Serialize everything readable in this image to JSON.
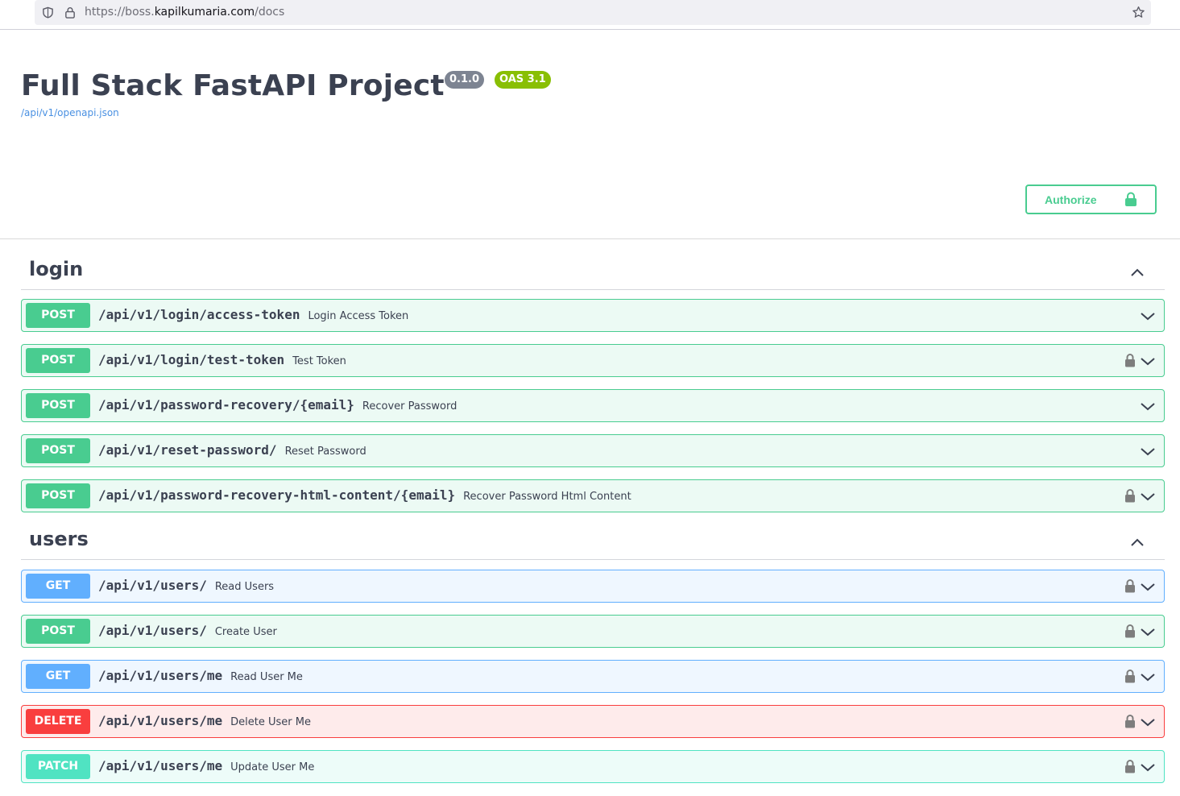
{
  "browser": {
    "url_prefix": "https://boss.",
    "url_domain": "kapilkumaria.com",
    "url_path": "/docs"
  },
  "info": {
    "title": "Full Stack FastAPI Project",
    "version": "0.1.0",
    "oas": "OAS 3.1",
    "spec_url": "/api/v1/openapi.json"
  },
  "authorize": {
    "label": "Authorize"
  },
  "colors": {
    "post": "#49cc90",
    "get": "#61affe",
    "delete": "#f93e3e",
    "patch": "#50e3c2",
    "text": "#3b4151"
  },
  "tags": [
    {
      "name": "login",
      "operations": [
        {
          "method": "POST",
          "path": "/api/v1/login/access-token",
          "summary": "Login Access Token",
          "locked": false
        },
        {
          "method": "POST",
          "path": "/api/v1/login/test-token",
          "summary": "Test Token",
          "locked": true
        },
        {
          "method": "POST",
          "path": "/api/v1/password-recovery/{email}",
          "summary": "Recover Password",
          "locked": false
        },
        {
          "method": "POST",
          "path": "/api/v1/reset-password/",
          "summary": "Reset Password",
          "locked": false
        },
        {
          "method": "POST",
          "path": "/api/v1/password-recovery-html-content/{email}",
          "summary": "Recover Password Html Content",
          "locked": true
        }
      ]
    },
    {
      "name": "users",
      "operations": [
        {
          "method": "GET",
          "path": "/api/v1/users/",
          "summary": "Read Users",
          "locked": true
        },
        {
          "method": "POST",
          "path": "/api/v1/users/",
          "summary": "Create User",
          "locked": true
        },
        {
          "method": "GET",
          "path": "/api/v1/users/me",
          "summary": "Read User Me",
          "locked": true
        },
        {
          "method": "DELETE",
          "path": "/api/v1/users/me",
          "summary": "Delete User Me",
          "locked": true
        },
        {
          "method": "PATCH",
          "path": "/api/v1/users/me",
          "summary": "Update User Me",
          "locked": true
        }
      ]
    }
  ]
}
